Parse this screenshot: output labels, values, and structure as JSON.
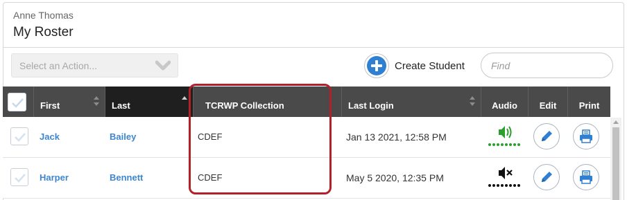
{
  "header": {
    "teacher_name": "Anne Thomas",
    "title": "My Roster"
  },
  "toolbar": {
    "action_placeholder": "Select an Action...",
    "create_label": "Create Student",
    "find_placeholder": "Find"
  },
  "columns": {
    "first": "First",
    "last": "Last",
    "collection": "TCRWP Collection",
    "last_login": "Last Login",
    "audio": "Audio",
    "edit": "Edit",
    "print": "Print"
  },
  "rows": [
    {
      "first": "Jack",
      "last": "Bailey",
      "collection": "CDEF",
      "last_login": "Jan 13 2021, 12:58 PM",
      "audio_icon": "speaker-on-icon",
      "audio_status": "on"
    },
    {
      "first": "Harper",
      "last": "Bennett",
      "collection": "CDEF",
      "last_login": "May 5 2020, 12:35 PM",
      "audio_icon": "speaker-muted-icon",
      "audio_status": "muted"
    }
  ],
  "colors": {
    "accent_blue": "#2f7fd3",
    "link_blue": "#3d86cf",
    "header_bg": "#4a4a4a",
    "header_sorted_bg": "#1f1f1f",
    "audio_on_green": "#2ca02c",
    "highlight_red": "#b2212a"
  }
}
